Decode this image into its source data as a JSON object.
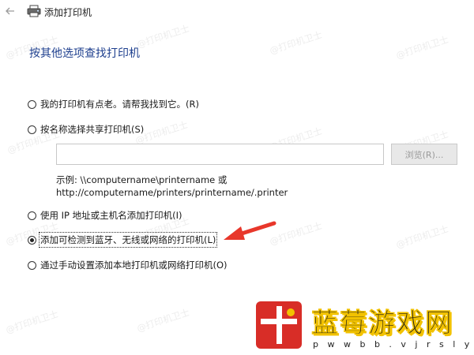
{
  "window": {
    "title": "添加打印机"
  },
  "heading": "按其他选项查找打印机",
  "options": [
    {
      "label": "我的打印机有点老。请帮我找到它。(R)",
      "checked": false,
      "focused": false
    },
    {
      "label": "按名称选择共享打印机(S)",
      "checked": false,
      "focused": false
    },
    {
      "label": "使用 IP 地址或主机名添加打印机(I)",
      "checked": false,
      "focused": false
    },
    {
      "label": "添加可检测到蓝牙、无线或网络的打印机(L)",
      "checked": true,
      "focused": true
    },
    {
      "label": "通过手动设置添加本地打印机或网络打印机(O)",
      "checked": false,
      "focused": false
    }
  ],
  "share_input": {
    "value": "",
    "placeholder": ""
  },
  "browse_button": {
    "label": "浏览(R)...",
    "enabled": false
  },
  "example": {
    "line1": "示例: \\\\computername\\printername 或",
    "line2": "http://computername/printers/printername/.printer"
  },
  "watermark": "@打印机卫士",
  "logo": {
    "name": "蓝莓游戏网",
    "url": "p w w b b . v j r s l y q c . c o m"
  },
  "colors": {
    "heading": "#1e3f8e",
    "arrow": "#e8372b",
    "logo_red": "#d82d27",
    "logo_yellow": "#f2c200"
  }
}
